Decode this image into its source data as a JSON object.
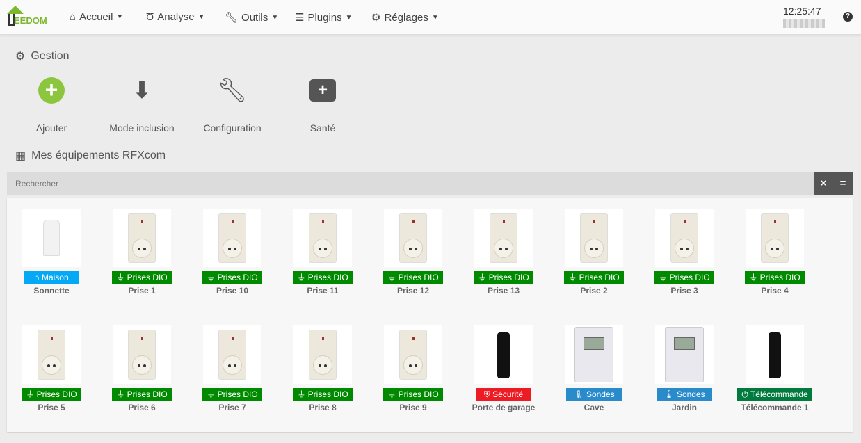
{
  "nav": {
    "logo": "EEDOM",
    "menus": [
      {
        "label": "Accueil",
        "icon": "home-icon"
      },
      {
        "label": "Analyse",
        "icon": "stethoscope-icon"
      },
      {
        "label": "Outils",
        "icon": "wrench-icon"
      },
      {
        "label": "Plugins",
        "icon": "list-check-icon"
      },
      {
        "label": "Réglages",
        "icon": "gear-icon"
      }
    ],
    "time": "12:25:47",
    "help": "?"
  },
  "gestion": {
    "title": "Gestion",
    "actions": [
      {
        "label": "Ajouter",
        "icon": "plus-circle-icon"
      },
      {
        "label": "Mode inclusion",
        "icon": "download-icon"
      },
      {
        "label": "Configuration",
        "icon": "wrench-icon"
      },
      {
        "label": "Santé",
        "icon": "medkit-icon"
      }
    ]
  },
  "equipements": {
    "title": "Mes équipements RFXcom",
    "search_placeholder": "Rechercher",
    "clear": "×",
    "toggle": "="
  },
  "colors": {
    "maison": "#03a9f4",
    "prises": "#008a00",
    "securite": "#ed1c24",
    "sondes": "#2a8bca",
    "telecommande": "#007a3d",
    "accent": "#7cb82f"
  },
  "devices": [
    {
      "name": "Sonnette",
      "category": "Maison",
      "type": "maison",
      "img": "bell"
    },
    {
      "name": "Prise 1",
      "category": "Prises DIO",
      "type": "prises",
      "img": "plug"
    },
    {
      "name": "Prise 10",
      "category": "Prises DIO",
      "type": "prises",
      "img": "plug"
    },
    {
      "name": "Prise 11",
      "category": "Prises DIO",
      "type": "prises",
      "img": "plug"
    },
    {
      "name": "Prise 12",
      "category": "Prises DIO",
      "type": "prises",
      "img": "plug"
    },
    {
      "name": "Prise 13",
      "category": "Prises DIO",
      "type": "prises",
      "img": "plug"
    },
    {
      "name": "Prise 2",
      "category": "Prises DIO",
      "type": "prises",
      "img": "plug"
    },
    {
      "name": "Prise 3",
      "category": "Prises DIO",
      "type": "prises",
      "img": "plug"
    },
    {
      "name": "Prise 4",
      "category": "Prises DIO",
      "type": "prises",
      "img": "plug"
    },
    {
      "name": "Prise 5",
      "category": "Prises DIO",
      "type": "prises",
      "img": "plug"
    },
    {
      "name": "Prise 6",
      "category": "Prises DIO",
      "type": "prises",
      "img": "plug"
    },
    {
      "name": "Prise 7",
      "category": "Prises DIO",
      "type": "prises",
      "img": "plug"
    },
    {
      "name": "Prise 8",
      "category": "Prises DIO",
      "type": "prises",
      "img": "plug"
    },
    {
      "name": "Prise 9",
      "category": "Prises DIO",
      "type": "prises",
      "img": "plug"
    },
    {
      "name": "Porte de garage",
      "category": "Sécurité",
      "type": "securite",
      "img": "remote"
    },
    {
      "name": "Cave",
      "category": "Sondes",
      "type": "sondes",
      "img": "thermo"
    },
    {
      "name": "Jardin",
      "category": "Sondes",
      "type": "sondes",
      "img": "thermo"
    },
    {
      "name": "Télécommande 1",
      "category": "Télécommande",
      "type": "telecommande",
      "img": "remote"
    }
  ]
}
